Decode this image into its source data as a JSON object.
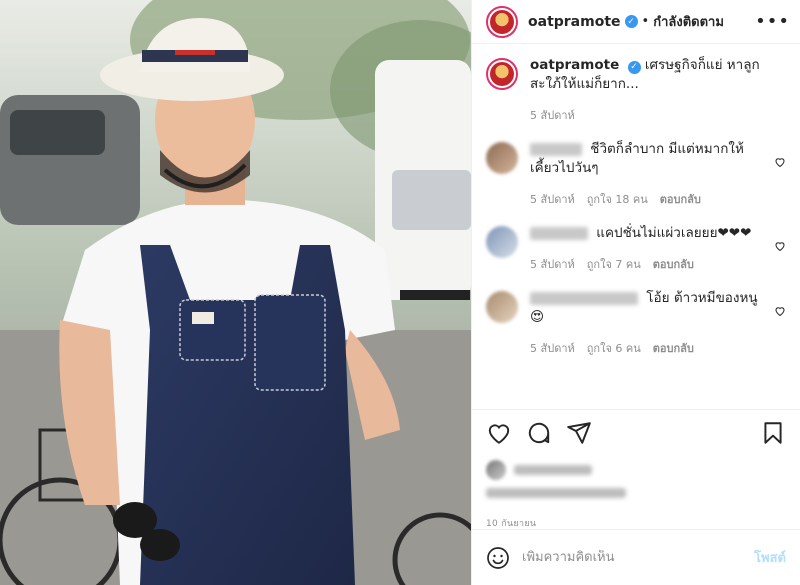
{
  "post": {
    "username": "oatpramote",
    "follow_status": "กำลังติดตาม",
    "caption": "เศรษฐกิจก็แย่ หาลูกสะใภ้ให้แม่ก็ยาก...",
    "caption_time": "5 สัปดาห์",
    "date": "10 กันยายน"
  },
  "comments": [
    {
      "text": "ชีวิตก็ลำบาก มีแต่หมากให้เคี้ยวไปวันๆ",
      "time": "5 สัปดาห์",
      "likes": "ถูกใจ 18 คน",
      "reply": "ตอบกลับ"
    },
    {
      "text": "แคปชั่นไม่แผ่วเลยยย❤❤❤",
      "time": "5 สัปดาห์",
      "likes": "ถูกใจ 7 คน",
      "reply": "ตอบกลับ"
    },
    {
      "text": "โอ้ย ต้าวหมีของหนู",
      "emoji": "😍",
      "time": "5 สัปดาห์",
      "likes": "ถูกใจ 6 คน",
      "reply": "ตอบกลับ"
    }
  ],
  "add_comment": {
    "placeholder": "เพิ่มความคิดเห็น",
    "post_label": "โพสต์"
  },
  "icons": {
    "like": "heart-icon",
    "comment": "comment-icon",
    "share": "share-icon",
    "save": "bookmark-icon",
    "emoji": "smile-icon",
    "verified": "verified-badge-icon"
  },
  "colors": {
    "accent": "#3897f0",
    "post_disabled": "#b2dffc",
    "muted": "#8e8e8e"
  }
}
